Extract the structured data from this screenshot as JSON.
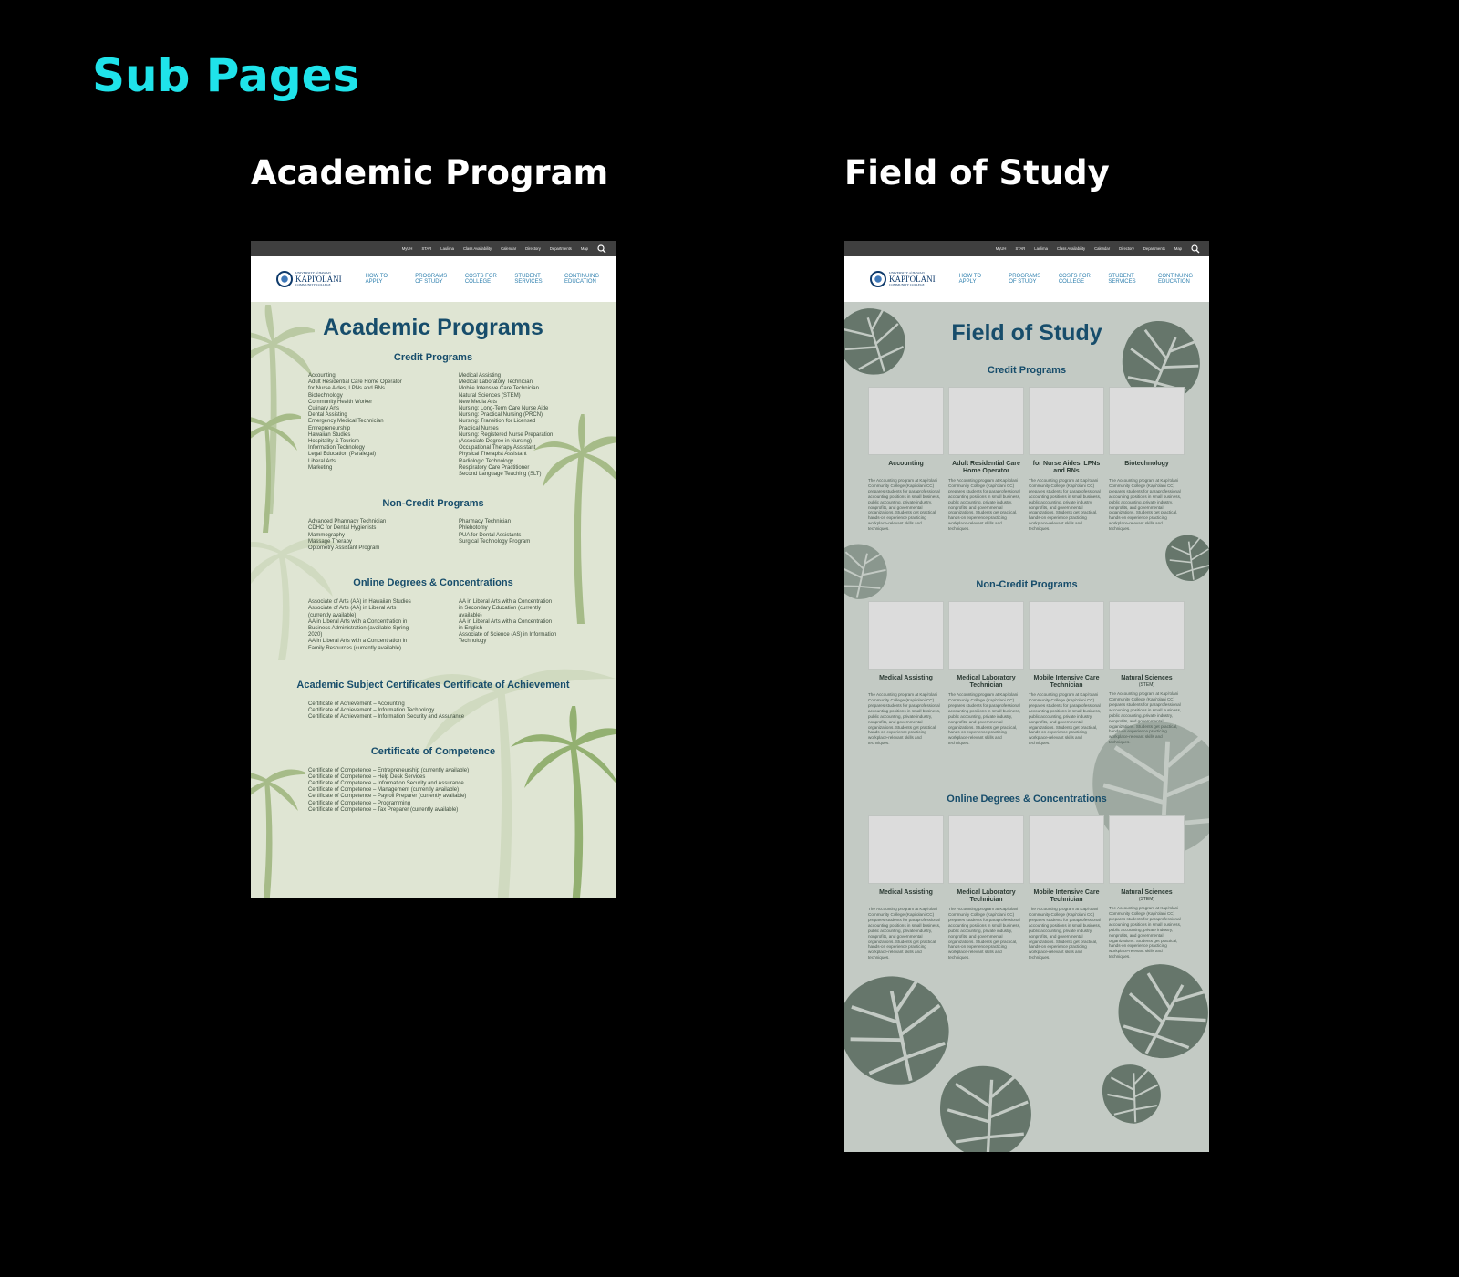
{
  "page": {
    "heading": "Sub Pages"
  },
  "labels": {
    "academic": "Academic Program",
    "field": "Field of Study"
  },
  "utility_nav": [
    "MyUH",
    "STAR",
    "Laulima",
    "Class Availability",
    "Calendar",
    "Directory",
    "Departments",
    "Map"
  ],
  "logo": {
    "line1": "UNIVERSITY of HAWAI'I",
    "name": "KAPI'OLANI",
    "line3": "COMMUNITY COLLEGE"
  },
  "main_nav": [
    "HOW TO APPLY",
    "PROGRAMS OF STUDY",
    "COSTS FOR COLLEGE",
    "STUDENT SERVICES",
    "CONTINUING EDUCATION"
  ],
  "academic": {
    "title": "Academic Programs",
    "credit_title": "Credit Programs",
    "credit_left": [
      "Accounting",
      "Adult Residential Care Home Operator",
      "for Nurse Aides, LPNs and RNs",
      "Biotechnology",
      "Community Health Worker",
      "Culinary Arts",
      "Dental Assisting",
      "Emergency Medical Technician",
      "Entrepreneurship",
      "Hawaiian Studies",
      "Hospitality & Tourism",
      "Information Technology",
      "Legal Education (Paralegal)",
      "Liberal Arts",
      "Marketing"
    ],
    "credit_right": [
      "Medical Assisting",
      "Medical Laboratory Technician",
      "Mobile Intensive Care Technician",
      "Natural Sciences (STEM)",
      "New Media Arts",
      "Nursing: Long-Term Care Nurse Aide",
      "Nursing: Practical Nursing (PRCN)",
      "Nursing: Transition for Licensed",
      "Practical Nurses",
      "Nursing: Registered Nurse Preparation",
      "(Associate Degree in Nursing)",
      "Occupational Therapy Assistant",
      "Physical Therapist Assistant",
      "Radiologic Technology",
      "Respiratory Care Practitioner",
      "Second Language Teaching (SLT)"
    ],
    "noncredit_title": "Non-Credit Programs",
    "noncredit_left": [
      "Advanced Pharmacy Technician",
      "CDHC for Dental Hygienists",
      "Mammography",
      "Massage Therapy",
      "Optometry Assistant Program"
    ],
    "noncredit_right": [
      "Pharmacy Technician",
      "Phlebotomy",
      "PUA for Dental Assistants",
      "Surgical Technology Program"
    ],
    "online_title": "Online Degrees & Concentrations",
    "online_left": [
      "Associate of Arts (AA) in Hawaiian Studies",
      "Associate of Arts (AA) in Liberal Arts",
      "(currently available)",
      "AA in Liberal Arts with a Concentration in",
      "Business Administration (available Spring",
      "2020)",
      "AA in Liberal Arts with a Concentration in",
      "Family Resources (currently available)"
    ],
    "online_right": [
      "AA in Liberal Arts with a Concentration",
      "in Secondary Education (currently",
      "available)",
      "AA in Liberal Arts with a Concentration",
      "in English",
      "Associate of Science (AS) in Information",
      "Technology"
    ],
    "asc_title": "Academic Subject Certificates Certificate of Achievement",
    "asc_items": [
      "Certificate of Achievement – Accounting",
      "Certificate of Achievement – Information Technology",
      "Certificate of Achievement – Information Security and Assurance"
    ],
    "coc_title": "Certificate of Competence",
    "coc_items": [
      "Certificate of Competence – Entrepreneurship (currently available)",
      "Certificate of Competence – Help Desk Services",
      "Certificate of Competence – Information Security and Assurance",
      "Certificate of Competence – Management (currently available)",
      "Certificate of Competence – Payroll Preparer (currently available)",
      "Certificate of Competence – Programming",
      "Certificate of Competence – Tax Preparer (currently available)"
    ]
  },
  "field": {
    "title": "Field of Study",
    "desc": "The Accounting program at Kapi'olani Community College (Kapi'olani CC) prepares students for paraprofessional accounting positions in small business, public accounting, private industry, nonprofits, and governmental organizations. Students get practical, hands-on experience practicing workplace-relevant skills and techniques.",
    "sections": [
      {
        "title": "Credit Programs",
        "cards": [
          {
            "title": "Accounting",
            "sub": ""
          },
          {
            "title": "Adult Residential Care Home Operator",
            "sub": ""
          },
          {
            "title": "for Nurse Aides, LPNs and RNs",
            "sub": ""
          },
          {
            "title": "Biotechnology",
            "sub": ""
          }
        ]
      },
      {
        "title": "Non-Credit Programs",
        "cards": [
          {
            "title": "Medical Assisting",
            "sub": ""
          },
          {
            "title": "Medical Laboratory Technician",
            "sub": ""
          },
          {
            "title": "Mobile Intensive Care Technician",
            "sub": ""
          },
          {
            "title": "Natural Sciences",
            "sub": "(STEM)"
          }
        ]
      },
      {
        "title": "Online Degrees & Concentrations",
        "cards": [
          {
            "title": "Medical Assisting",
            "sub": ""
          },
          {
            "title": "Medical Laboratory Technician",
            "sub": ""
          },
          {
            "title": "Mobile Intensive Care Technician",
            "sub": ""
          },
          {
            "title": "Natural Sciences",
            "sub": "(STEM)"
          }
        ]
      }
    ]
  },
  "colors": {
    "accent": "#1fe3ea",
    "title": "#174d6b",
    "nav": "#2d7fae"
  },
  "icons": [
    "search-icon",
    "palm-tree-icon",
    "monstera-leaf-icon",
    "college-seal-icon"
  ]
}
